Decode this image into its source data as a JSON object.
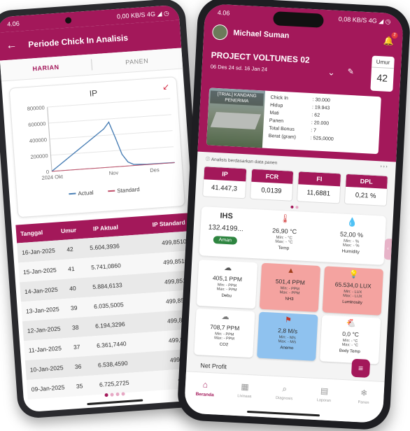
{
  "left": {
    "status": {
      "time": "4.06",
      "net": "0,00 KB/S",
      "signal": "4G ◢ ◷"
    },
    "appbar": {
      "title": "Periode Chick In Analisis"
    },
    "tabs": [
      {
        "label": "HARIAN"
      },
      {
        "label": "PANEN"
      }
    ],
    "chart": {
      "title": "IP"
    },
    "table": {
      "headers": [
        "Tanggal",
        "Umur",
        "IP Aktual",
        "IP Standard"
      ],
      "rows": [
        [
          "16-Jan-2025",
          "42",
          "5.604,3936",
          "499,8510"
        ],
        [
          "15-Jan-2025",
          "41",
          "5.741,0860",
          "499,8510"
        ],
        [
          "14-Jan-2025",
          "40",
          "5.884,6133",
          "499,8510"
        ],
        [
          "13-Jan-2025",
          "39",
          "6.035,5005",
          "499,8510"
        ],
        [
          "12-Jan-2025",
          "38",
          "6.194,3296",
          "499,8510"
        ],
        [
          "11-Jan-2025",
          "37",
          "6.361,7440",
          "499,8510"
        ],
        [
          "10-Jan-2025",
          "36",
          "6.538,4590",
          "499,8510"
        ],
        [
          "09-Jan-2025",
          "35",
          "6.725,2725",
          "499,85"
        ]
      ]
    }
  },
  "chart_data": {
    "type": "line",
    "title": "IP",
    "x_tick_labels": [
      "2024 Okt",
      "Nov",
      "Des"
    ],
    "y_ticks": [
      0,
      200000,
      400000,
      600000,
      800000
    ],
    "y_tick_labels": [
      "0",
      "200000",
      "400000",
      "600000",
      "800000"
    ],
    "ylim": [
      0,
      800000
    ],
    "x_range": [
      0,
      90
    ],
    "series": [
      {
        "name": "Actual",
        "color": "#4a7fb5",
        "points": [
          [
            0,
            0
          ],
          [
            5,
            60000
          ],
          [
            10,
            120000
          ],
          [
            15,
            180000
          ],
          [
            20,
            240000
          ],
          [
            25,
            300000
          ],
          [
            30,
            360000
          ],
          [
            35,
            420000
          ],
          [
            40,
            480000
          ],
          [
            44,
            560000
          ],
          [
            48,
            360000
          ],
          [
            52,
            150000
          ],
          [
            56,
            50000
          ],
          [
            60,
            15000
          ],
          [
            70,
            5000
          ],
          [
            90,
            2000
          ]
        ]
      },
      {
        "name": "Standard",
        "color": "#c0506a",
        "points": [
          [
            0,
            0
          ],
          [
            90,
            500
          ]
        ]
      }
    ],
    "legend": "bottom"
  },
  "right": {
    "status": {
      "time": "4.06",
      "net": "0,08 KB/S",
      "signal": "4G ◢ ◷"
    },
    "user": {
      "name": "Michael Suman",
      "badge": "2"
    },
    "project": {
      "name": "PROJECT VOLTUNES 02",
      "dates": "06 Des 24 sd. 16 Jan 24"
    },
    "umur": {
      "label": "Umur",
      "value": "42"
    },
    "kandang": {
      "caption": "[TRIAL] KANDANG PENERIMA",
      "items": [
        {
          "label": "Chick In",
          "value": ": 30.000"
        },
        {
          "label": "Hidup",
          "value": ": 19.943"
        },
        {
          "label": "Mati",
          "value": ": 62"
        },
        {
          "label": "Panen",
          "value": ": 20.000"
        },
        {
          "label": "Total Bonus",
          "value": ": 7"
        },
        {
          "label": "Berat (gram)",
          "value": ": 525,0000"
        }
      ]
    },
    "note": {
      "text": "Analisis berdasarkan data panen",
      "arrows": "› › ›"
    },
    "kpis": [
      {
        "label": "IP",
        "value": "41.447,3"
      },
      {
        "label": "FCR",
        "value": "0,0139"
      },
      {
        "label": "FI",
        "value": "11,6881"
      },
      {
        "label": "DPL",
        "value": "0,21 %"
      }
    ],
    "ihs": {
      "label": "IHS",
      "value": "132.4199...",
      "status": "Aman"
    },
    "env": [
      {
        "icon": "thermometer-icon",
        "value": "26,90 °C",
        "min": "Min: - °C",
        "max": "Max: - °C",
        "label": "Temp"
      },
      {
        "icon": "droplet-icon",
        "value": "52,00 %",
        "min": "Min: - %",
        "max": "Max: - %",
        "label": "Humidity"
      }
    ],
    "sensors_row1": [
      {
        "value": "405,1 PPM",
        "min": "Min: - PPM",
        "max": "Max: - PPM",
        "label": "Debu",
        "color": "white"
      },
      {
        "value": "501,4 PPM",
        "min": "Min: - PPM",
        "max": "Max: - PPM",
        "label": "NH3",
        "color": "red"
      },
      {
        "value": "65.534,0 LUX",
        "min": "Min: - LUX",
        "max": "Max: - LUX",
        "label": "Luminosity",
        "color": "red"
      }
    ],
    "sensors_row2": [
      {
        "value": "708,7 PPM",
        "min": "Min: - PPM",
        "max": "Max: - PPM",
        "label": "CO2",
        "color": "white"
      },
      {
        "value": "2,8 M/s",
        "min": "Min: - M/s",
        "max": "Max: - M/s",
        "label": "Anemo",
        "color": "blue"
      },
      {
        "value": "0,0 °C",
        "min": "Min: - °C",
        "max": "Max: - °C",
        "label": "Body Temp",
        "color": "white"
      }
    ],
    "netprofit": "Net Profit",
    "nav": [
      {
        "label": "Beranda",
        "icon": "home-icon"
      },
      {
        "label": "Livinaas",
        "icon": "calendar-icon"
      },
      {
        "label": "Diagnosis",
        "icon": "search-icon"
      },
      {
        "label": "Laporan",
        "icon": "document-icon"
      },
      {
        "label": "Panen",
        "icon": "snowflake-icon"
      }
    ]
  }
}
